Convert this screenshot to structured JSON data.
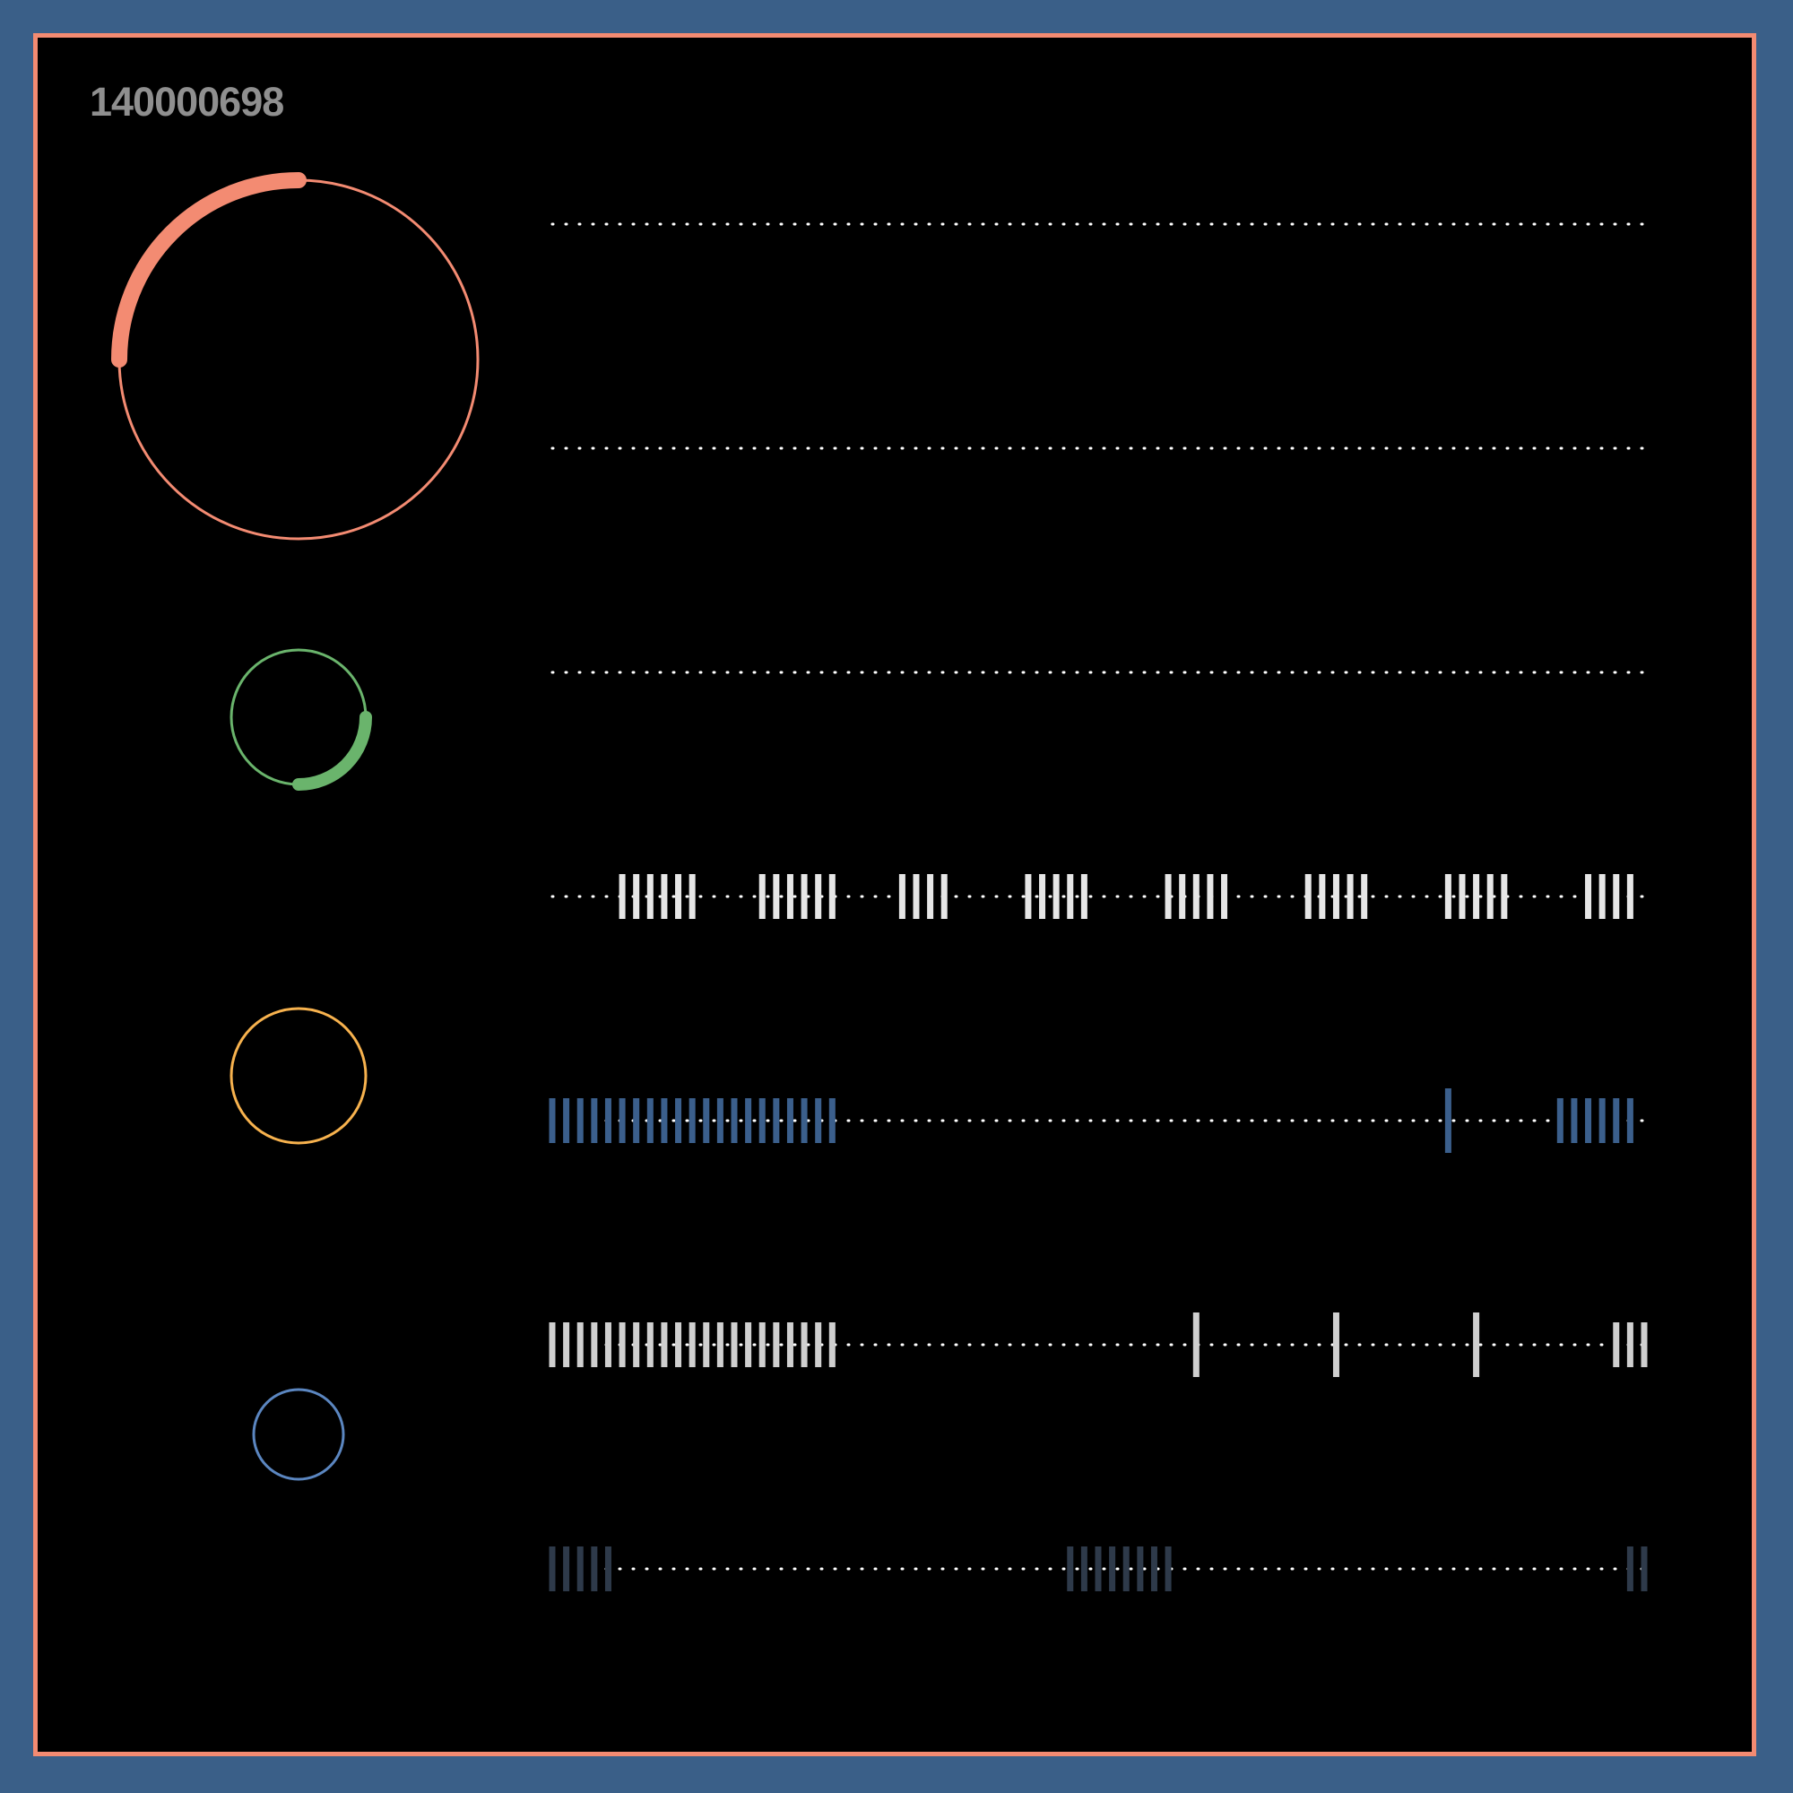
{
  "header": {
    "id_text": "140000698"
  },
  "colors": {
    "background": "#3a5f88",
    "panel": "#000000",
    "border": "#f38b72",
    "label": "#8f8f8f",
    "dots": "#ffffff"
  },
  "gauges": [
    {
      "name": "gauge-salmon",
      "color": "#f38b72",
      "progress": 0.25
    },
    {
      "name": "gauge-green",
      "color": "#6ab46c",
      "progress": 0.25
    },
    {
      "name": "gauge-orange",
      "color": "#f7b24e",
      "progress": 0.0
    },
    {
      "name": "gauge-blue",
      "color": "#5b86c0",
      "progress": 0.0
    }
  ],
  "tracks": [
    {
      "name": "track-1",
      "color": "#ffffff",
      "ticks": []
    },
    {
      "name": "track-2",
      "color": "#ffffff",
      "ticks": []
    },
    {
      "name": "track-3",
      "color": "#ffffff",
      "ticks": []
    },
    {
      "name": "track-4",
      "color": "#e6e6e6",
      "ticks": [
        5,
        6,
        7,
        8,
        9,
        10,
        15,
        16,
        17,
        18,
        19,
        20,
        25,
        26,
        27,
        28,
        34,
        35,
        36,
        37,
        38,
        44,
        45,
        46,
        47,
        48,
        54,
        55,
        56,
        57,
        58,
        64,
        65,
        66,
        67,
        68,
        74,
        75,
        76,
        77
      ]
    },
    {
      "name": "track-5",
      "color": "#3b5f8c",
      "ticks": [
        0,
        1,
        2,
        3,
        4,
        5,
        6,
        7,
        8,
        9,
        10,
        11,
        12,
        13,
        14,
        15,
        16,
        17,
        18,
        19,
        20,
        64,
        72,
        73,
        74,
        75,
        76,
        77
      ]
    },
    {
      "name": "track-6",
      "color": "#cfcfcf",
      "ticks": [
        0,
        1,
        2,
        3,
        4,
        5,
        6,
        7,
        8,
        9,
        10,
        11,
        12,
        13,
        14,
        15,
        16,
        17,
        18,
        19,
        20,
        46,
        56,
        66,
        76,
        77,
        78
      ]
    },
    {
      "name": "track-7",
      "color": "#2e3a4a",
      "ticks": [
        0,
        1,
        2,
        3,
        4,
        37,
        38,
        39,
        40,
        41,
        42,
        43,
        44,
        77,
        78
      ]
    }
  ]
}
